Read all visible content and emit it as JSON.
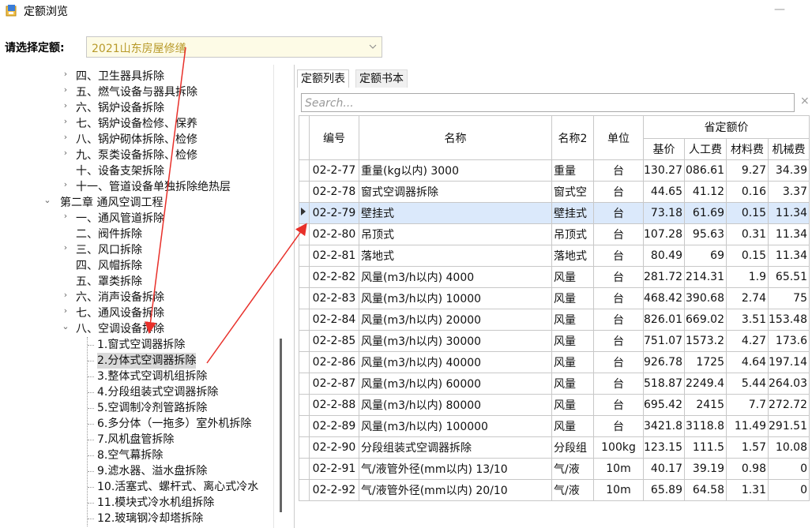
{
  "window": {
    "title": "定额浏览",
    "minimize": "—"
  },
  "selector": {
    "label": "请选择定额:",
    "value": "2021山东房屋修缮"
  },
  "tree": {
    "items": [
      {
        "label": "四、卫生器具拆除",
        "chev": "›"
      },
      {
        "label": "五、燃气设备与器具拆除",
        "chev": "›"
      },
      {
        "label": "六、锅炉设备拆除",
        "chev": "›"
      },
      {
        "label": "七、锅炉设备检修、保养",
        "chev": "›"
      },
      {
        "label": "八、锅炉砌体拆除、检修",
        "chev": "›"
      },
      {
        "label": "九、泵类设备拆除、检修",
        "chev": "›"
      },
      {
        "label": "十、设备支架拆除",
        "chev": ""
      },
      {
        "label": "十一、管道设备单独拆除绝热层",
        "chev": "›"
      },
      {
        "label": "第二章 通风空调工程",
        "chev": "⌄"
      },
      {
        "label": "一、通风管道拆除",
        "chev": "›"
      },
      {
        "label": "二、阀件拆除",
        "chev": ""
      },
      {
        "label": "三、风口拆除",
        "chev": "›"
      },
      {
        "label": "四、风帽拆除",
        "chev": ""
      },
      {
        "label": "五、罩类拆除",
        "chev": ""
      },
      {
        "label": "六、消声设备拆除",
        "chev": "›"
      },
      {
        "label": "七、通风设备拆除",
        "chev": "›"
      },
      {
        "label": "八、空调设备拆除",
        "chev": "⌄"
      },
      {
        "label": "1.窗式空调器拆除",
        "chev": ""
      },
      {
        "label": "2.分体式空调器拆除",
        "chev": ""
      },
      {
        "label": "3.整体式空调机组拆除",
        "chev": ""
      },
      {
        "label": "4.分段组装式空调器拆除",
        "chev": ""
      },
      {
        "label": "5.空调制冷剂管路拆除",
        "chev": ""
      },
      {
        "label": "6.多分体（一拖多）室外机拆除",
        "chev": ""
      },
      {
        "label": "7.风机盘管拆除",
        "chev": ""
      },
      {
        "label": "8.空气幕拆除",
        "chev": ""
      },
      {
        "label": "9.滤水器、溢水盘拆除",
        "chev": ""
      },
      {
        "label": "10.活塞式、螺杆式、离心式冷水",
        "chev": ""
      },
      {
        "label": "11.模块式冷水机组拆除",
        "chev": ""
      },
      {
        "label": "12.玻璃钢冷却塔拆除",
        "chev": ""
      }
    ]
  },
  "tabs": [
    "定额列表",
    "定额书本"
  ],
  "search": {
    "placeholder": "Search...",
    "clear": "×"
  },
  "table": {
    "headers": {
      "code": "编号",
      "name": "名称",
      "name2": "名称2",
      "unit": "单位",
      "group": "省定额价",
      "base": "基价",
      "labor": "人工费",
      "material": "材料费",
      "machine": "机械费"
    },
    "rows": [
      {
        "code": "02-2-77",
        "name": "重量(kg以内) 3000",
        "name2": "重量",
        "unit": "台",
        "base": "130.27",
        "labor": "086.61",
        "material": "9.27",
        "machine": "34.39"
      },
      {
        "code": "02-2-78",
        "name": "窗式空调器拆除",
        "name2": "窗式空",
        "unit": "台",
        "base": "44.65",
        "labor": "41.12",
        "material": "0.16",
        "machine": "3.37"
      },
      {
        "code": "02-2-79",
        "name": "壁挂式",
        "name2": "壁挂式",
        "unit": "台",
        "base": "73.18",
        "labor": "61.69",
        "material": "0.15",
        "machine": "11.34"
      },
      {
        "code": "02-2-80",
        "name": "吊顶式",
        "name2": "吊顶式",
        "unit": "台",
        "base": "107.28",
        "labor": "95.63",
        "material": "0.31",
        "machine": "11.34"
      },
      {
        "code": "02-2-81",
        "name": "落地式",
        "name2": "落地式",
        "unit": "台",
        "base": "80.49",
        "labor": "69",
        "material": "0.15",
        "machine": "11.34"
      },
      {
        "code": "02-2-82",
        "name": "风量(m3/h以内) 4000",
        "name2": "风量",
        "unit": "台",
        "base": "281.72",
        "labor": "214.31",
        "material": "1.9",
        "machine": "65.51"
      },
      {
        "code": "02-2-83",
        "name": "风量(m3/h以内) 10000",
        "name2": "风量",
        "unit": "台",
        "base": "468.42",
        "labor": "390.68",
        "material": "2.74",
        "machine": "75"
      },
      {
        "code": "02-2-84",
        "name": "风量(m3/h以内) 20000",
        "name2": "风量",
        "unit": "台",
        "base": "826.01",
        "labor": "669.02",
        "material": "3.51",
        "machine": "153.48"
      },
      {
        "code": "02-2-85",
        "name": "风量(m3/h以内) 30000",
        "name2": "风量",
        "unit": "台",
        "base": "751.07",
        "labor": "1573.2",
        "material": "4.27",
        "machine": "173.6"
      },
      {
        "code": "02-2-86",
        "name": "风量(m3/h以内) 40000",
        "name2": "风量",
        "unit": "台",
        "base": "926.78",
        "labor": "1725",
        "material": "4.64",
        "machine": "197.14"
      },
      {
        "code": "02-2-87",
        "name": "风量(m3/h以内) 60000",
        "name2": "风量",
        "unit": "台",
        "base": "518.87",
        "labor": "2249.4",
        "material": "5.44",
        "machine": "264.03"
      },
      {
        "code": "02-2-88",
        "name": "风量(m3/h以内) 80000",
        "name2": "风量",
        "unit": "台",
        "base": "695.42",
        "labor": "2415",
        "material": "7.7",
        "machine": "272.72"
      },
      {
        "code": "02-2-89",
        "name": "风量(m3/h以内) 100000",
        "name2": "风量",
        "unit": "台",
        "base": "3421.8",
        "labor": "3118.8",
        "material": "11.49",
        "machine": "291.51"
      },
      {
        "code": "02-2-90",
        "name": "分段组装式空调器拆除",
        "name2": "分段组",
        "unit": "100kg",
        "base": "123.15",
        "labor": "111.5",
        "material": "1.57",
        "machine": "10.08"
      },
      {
        "code": "02-2-91",
        "name": "气/液管外径(mm以内) 13/10",
        "name2": "气/液",
        "unit": "10m",
        "base": "40.17",
        "labor": "39.19",
        "material": "0.98",
        "machine": "0"
      },
      {
        "code": "02-2-92",
        "name": "气/液管外径(mm以内) 20/10",
        "name2": "气/液",
        "unit": "10m",
        "base": "65.89",
        "labor": "64.58",
        "material": "1.31",
        "machine": "0"
      }
    ]
  },
  "colors": {
    "select_bg": "#fdfbe6",
    "select_text": "#b89a2a",
    "current_row": "#dbe9fb",
    "annotation_arrow": "#e8302a"
  }
}
